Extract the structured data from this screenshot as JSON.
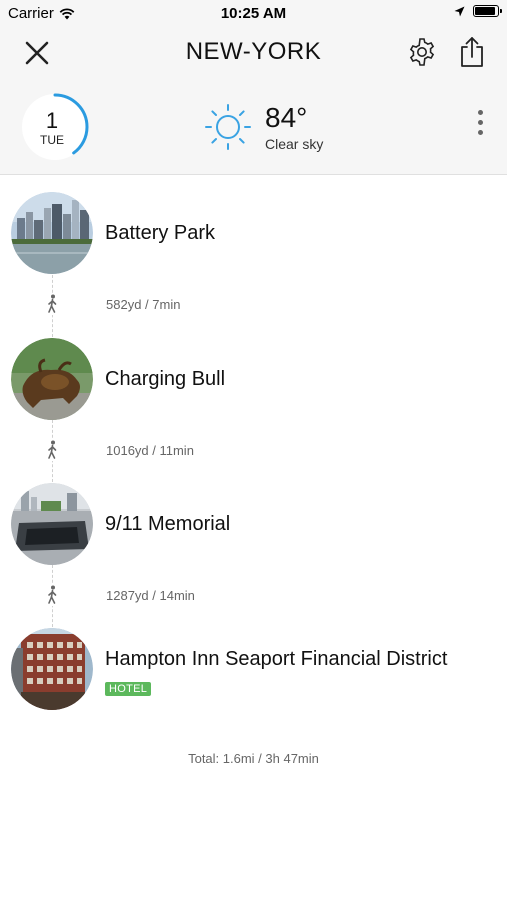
{
  "status_bar": {
    "carrier": "Carrier",
    "time": "10:25 AM",
    "icons": [
      "wifi-icon",
      "location-arrow-icon",
      "battery-icon"
    ]
  },
  "nav": {
    "title": "NEW-YORK",
    "close_icon": "close-icon",
    "settings_icon": "gear-icon",
    "share_icon": "share-icon"
  },
  "day": {
    "number": "1",
    "weekday": "TUE",
    "progress": 0.4,
    "accent_color": "#2b9be0"
  },
  "weather": {
    "icon": "sun-icon",
    "temperature": "84°",
    "condition": "Clear sky",
    "icon_color": "#3aa3e3"
  },
  "stops": [
    {
      "name": "Battery Park",
      "badge": "",
      "photo_icon": "battery-park-photo"
    },
    {
      "name": "Charging Bull",
      "badge": "",
      "photo_icon": "charging-bull-photo"
    },
    {
      "name": "9/11 Memorial",
      "badge": "",
      "photo_icon": "memorial-photo"
    },
    {
      "name": "Hampton Inn Seaport Financial District",
      "badge": "HOTEL",
      "photo_icon": "hotel-photo"
    }
  ],
  "legs": [
    {
      "text": "582yd / 7min",
      "icon": "walk-icon"
    },
    {
      "text": "1016yd / 11min",
      "icon": "walk-icon"
    },
    {
      "text": "1287yd / 14min",
      "icon": "walk-icon"
    }
  ],
  "total": "Total: 1.6mi / 3h 47min",
  "colors": {
    "hotel_badge": "#5cb85c",
    "header_bg": "#f6f6f6"
  }
}
